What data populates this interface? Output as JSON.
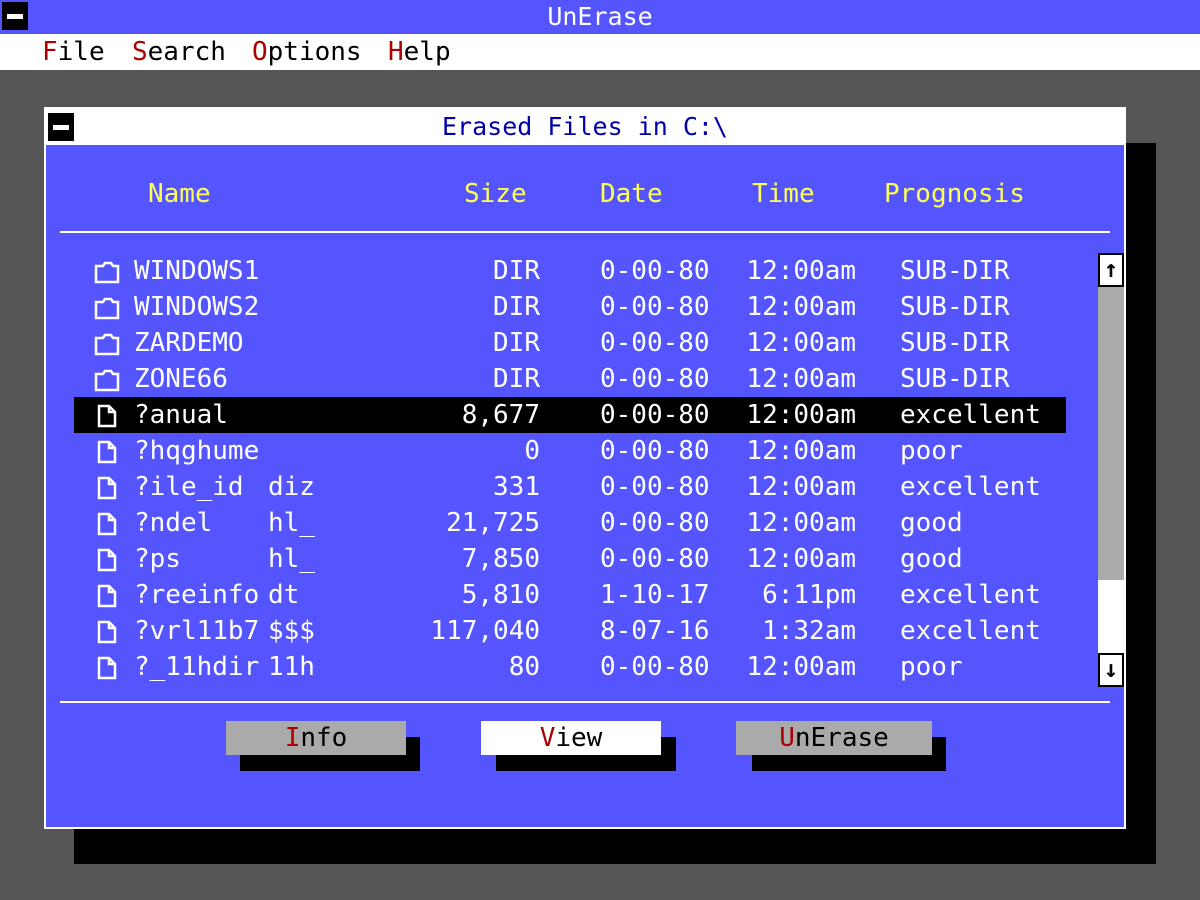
{
  "app": {
    "title": "UnErase"
  },
  "menu": {
    "items": [
      {
        "hot": "F",
        "rest": "ile"
      },
      {
        "hot": "S",
        "rest": "earch"
      },
      {
        "hot": "O",
        "rest": "ptions"
      },
      {
        "hot": "H",
        "rest": "elp"
      }
    ]
  },
  "dialog": {
    "title": "Erased Files in C:\\",
    "columns": {
      "name": "Name",
      "size": "Size",
      "date": "Date",
      "time": "Time",
      "prognosis": "Prognosis"
    },
    "selected_index": 4,
    "files": [
      {
        "icon": "folder-icon",
        "name": "WINDOWS1",
        "ext": "",
        "size": "DIR",
        "date": "0-00-80",
        "time": "12:00am",
        "prognosis": "SUB-DIR"
      },
      {
        "icon": "folder-icon",
        "name": "WINDOWS2",
        "ext": "",
        "size": "DIR",
        "date": "0-00-80",
        "time": "12:00am",
        "prognosis": "SUB-DIR"
      },
      {
        "icon": "folder-icon",
        "name": "ZARDEMO",
        "ext": "",
        "size": "DIR",
        "date": "0-00-80",
        "time": "12:00am",
        "prognosis": "SUB-DIR"
      },
      {
        "icon": "folder-icon",
        "name": "ZONE66",
        "ext": "",
        "size": "DIR",
        "date": "0-00-80",
        "time": "12:00am",
        "prognosis": "SUB-DIR"
      },
      {
        "icon": "file-icon",
        "name": "?anual",
        "ext": "",
        "size": "8,677",
        "date": "0-00-80",
        "time": "12:00am",
        "prognosis": "excellent"
      },
      {
        "icon": "file-icon",
        "name": "?hqghume",
        "ext": "",
        "size": "0",
        "date": "0-00-80",
        "time": "12:00am",
        "prognosis": "poor"
      },
      {
        "icon": "file-icon",
        "name": "?ile_id",
        "ext": "diz",
        "size": "331",
        "date": "0-00-80",
        "time": "12:00am",
        "prognosis": "excellent"
      },
      {
        "icon": "file-icon",
        "name": "?ndel",
        "ext": "hl_",
        "size": "21,725",
        "date": "0-00-80",
        "time": "12:00am",
        "prognosis": "good"
      },
      {
        "icon": "file-icon",
        "name": "?ps",
        "ext": "hl_",
        "size": "7,850",
        "date": "0-00-80",
        "time": "12:00am",
        "prognosis": "good"
      },
      {
        "icon": "file-icon",
        "name": "?reeinfo",
        "ext": "dt",
        "size": "5,810",
        "date": "1-10-17",
        "time": "6:11pm",
        "prognosis": "excellent"
      },
      {
        "icon": "file-icon",
        "name": "?vrl11b7",
        "ext": "$$$",
        "size": "117,040",
        "date": "8-07-16",
        "time": "1:32am",
        "prognosis": "excellent"
      },
      {
        "icon": "file-icon",
        "name": "?_11hdir",
        "ext": "11h",
        "size": "80",
        "date": "0-00-80",
        "time": "12:00am",
        "prognosis": "poor"
      }
    ],
    "scrollbar": {
      "up": "↑",
      "down": "↓",
      "thumb_position": 0.8
    },
    "buttons": [
      {
        "id": "info",
        "hot": "I",
        "rest": "nfo",
        "style": "gray"
      },
      {
        "id": "view",
        "hot": "V",
        "rest": "iew",
        "style": "white"
      },
      {
        "id": "unerase",
        "hot": "U",
        "rest": "nErase",
        "style": "gray"
      }
    ]
  },
  "colors": {
    "desktop": "#555555",
    "panel": "#5555ff",
    "header_text": "#ffff55",
    "hotkey": "#aa0000",
    "title_text": "#0000aa"
  }
}
